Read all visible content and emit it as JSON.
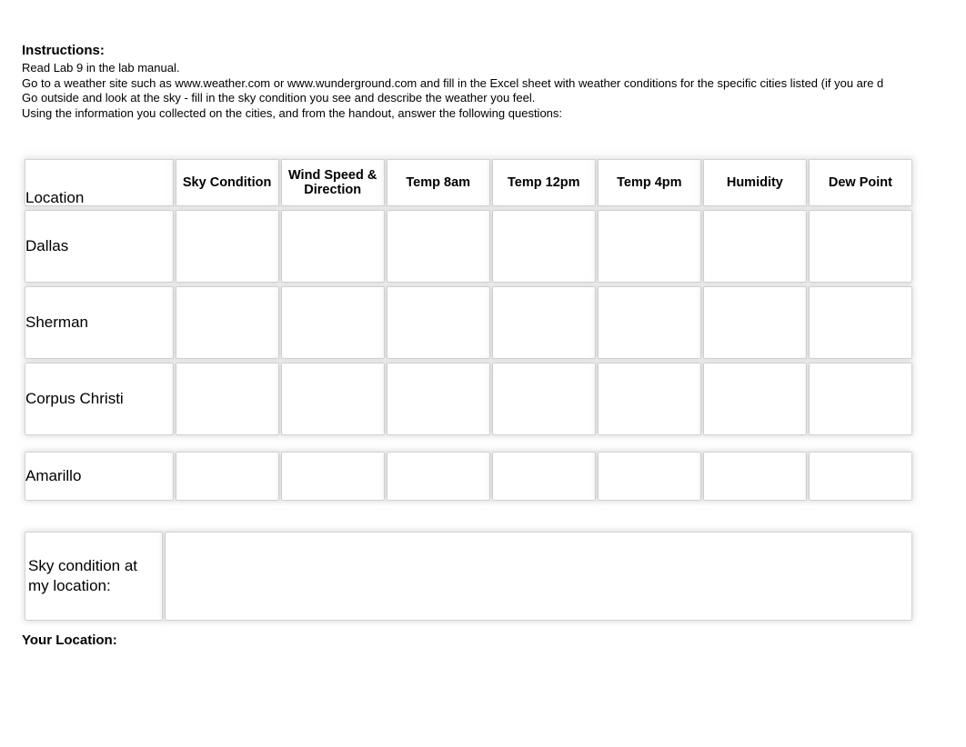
{
  "instructions": {
    "title": "Instructions:",
    "lines": [
      "Read Lab 9  in the lab manual.",
      "Go to a weather site such as www.weather.com or www.wunderground.com and fill in the Excel sheet with weather conditions for the specific cities listed (if you are d",
      "Go outside and look at the sky - fill in the sky condition you see and describe the weather you feel.",
      "Using the information you collected on the cities, and from the handout, answer the following questions:"
    ]
  },
  "table": {
    "headers": [
      "Location",
      "Sky Condition",
      "Wind Speed & Direction",
      "Temp 8am",
      "Temp 12pm",
      "Temp 4pm",
      "Humidity",
      "Dew Point"
    ],
    "rows": [
      {
        "location": "Dallas",
        "cells": [
          "",
          "",
          "",
          "",
          "",
          "",
          ""
        ]
      },
      {
        "location": "Sherman",
        "cells": [
          "",
          "",
          "",
          "",
          "",
          "",
          ""
        ]
      },
      {
        "location": "Corpus Christi",
        "cells": [
          "",
          "",
          "",
          "",
          "",
          "",
          ""
        ]
      }
    ],
    "detached_rows": [
      {
        "location": "Amarillo",
        "cells": [
          "",
          "",
          "",
          "",
          "",
          "",
          ""
        ]
      }
    ]
  },
  "sky_condition": {
    "label": "Sky condition at my location:",
    "value": ""
  },
  "your_location": {
    "label": "Your Location:"
  }
}
